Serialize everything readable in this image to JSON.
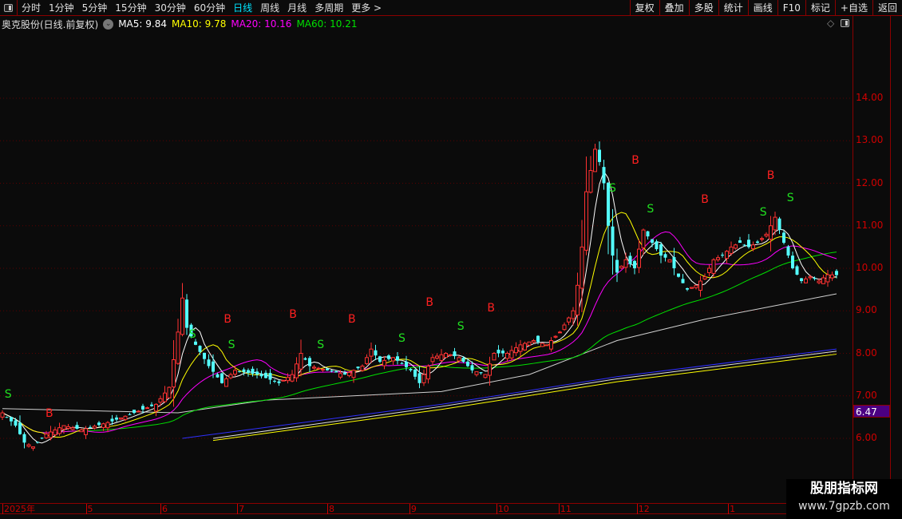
{
  "toolbar": {
    "periods": [
      "分时",
      "1分钟",
      "5分钟",
      "15分钟",
      "30分钟",
      "60分钟",
      "日线",
      "周线",
      "月线",
      "多周期",
      "更多 >"
    ],
    "active": "日线",
    "right_buttons": [
      "复权",
      "叠加",
      "多股",
      "统计",
      "画线",
      "F10",
      "标记",
      "+自选",
      "返回"
    ]
  },
  "info": {
    "title": "奥克股份(日线.前复权)",
    "ma5": "MA5: 9.84",
    "ma10": "MA10: 9.78",
    "ma20": "MA20: 10.16",
    "ma60": "MA60: 10.21"
  },
  "colors": {
    "up": "#ff3232",
    "down": "#54ffff",
    "ma5": "#ffffff",
    "ma10": "#ffff00",
    "ma20": "#ff00ff",
    "ma60": "#00e000",
    "buy": "#ff2020",
    "sell": "#20e020"
  },
  "axis": {
    "prices": [
      "14.00",
      "13.00",
      "12.00",
      "11.00",
      "10.00",
      "9.00",
      "8.00",
      "7.00",
      "6.00"
    ],
    "current_price": "6.47",
    "dates": [
      {
        "label": "2025年",
        "day": 0
      },
      {
        "label": "5",
        "day": 19
      },
      {
        "label": "6",
        "day": 36
      },
      {
        "label": "7",
        "day": 53.5
      },
      {
        "label": "8",
        "day": 74
      },
      {
        "label": "9",
        "day": 92.7
      },
      {
        "label": "10",
        "day": 112.5
      },
      {
        "label": "11",
        "day": 126.7
      },
      {
        "label": "12",
        "day": 144.5
      },
      {
        "label": "1",
        "day": 165.3
      }
    ]
  },
  "chart_data": {
    "type": "candlestick",
    "ylim": [
      5.0,
      15.0
    ],
    "close_keypoints": [
      [
        0,
        6.6
      ],
      [
        3,
        6.3
      ],
      [
        5,
        5.9
      ],
      [
        7,
        5.8
      ],
      [
        10,
        6.1
      ],
      [
        14,
        6.3
      ],
      [
        18,
        6.2
      ],
      [
        25,
        6.4
      ],
      [
        30,
        6.6
      ],
      [
        35,
        6.8
      ],
      [
        38,
        7.2
      ],
      [
        40,
        8.5
      ],
      [
        41,
        9.3
      ],
      [
        42,
        8.6
      ],
      [
        44,
        8.2
      ],
      [
        47,
        7.7
      ],
      [
        50,
        7.3
      ],
      [
        53,
        7.6
      ],
      [
        58,
        7.5
      ],
      [
        63,
        7.3
      ],
      [
        66,
        7.5
      ],
      [
        68,
        8.0
      ],
      [
        70,
        7.7
      ],
      [
        74,
        7.6
      ],
      [
        78,
        7.5
      ],
      [
        82,
        7.7
      ],
      [
        84,
        8.1
      ],
      [
        86,
        7.8
      ],
      [
        89,
        7.9
      ],
      [
        93,
        7.6
      ],
      [
        95,
        7.3
      ],
      [
        98,
        7.9
      ],
      [
        101,
        8.0
      ],
      [
        104,
        7.9
      ],
      [
        107,
        7.6
      ],
      [
        110,
        7.5
      ],
      [
        112,
        8.0
      ],
      [
        115,
        8.0
      ],
      [
        118,
        8.2
      ],
      [
        121,
        8.3
      ],
      [
        124,
        8.2
      ],
      [
        127,
        8.5
      ],
      [
        130,
        9.0
      ],
      [
        131,
        9.6
      ],
      [
        132,
        10.5
      ],
      [
        133,
        11.8
      ],
      [
        134,
        12.3
      ],
      [
        135,
        12.8
      ],
      [
        136,
        12.5
      ],
      [
        137,
        12.0
      ],
      [
        138,
        11.0
      ],
      [
        139,
        10.3
      ],
      [
        140,
        9.9
      ],
      [
        142,
        10.2
      ],
      [
        144,
        10.0
      ],
      [
        146,
        10.9
      ],
      [
        148,
        10.6
      ],
      [
        150,
        10.3
      ],
      [
        152,
        10.2
      ],
      [
        154,
        9.8
      ],
      [
        156,
        9.5
      ],
      [
        158,
        9.6
      ],
      [
        160,
        9.8
      ],
      [
        162,
        10.2
      ],
      [
        164,
        10.3
      ],
      [
        166,
        10.5
      ],
      [
        168,
        10.6
      ],
      [
        170,
        10.5
      ],
      [
        172,
        10.6
      ],
      [
        174,
        10.8
      ],
      [
        176,
        11.2
      ],
      [
        178,
        10.6
      ],
      [
        180,
        10.0
      ],
      [
        182,
        9.7
      ],
      [
        184,
        9.8
      ],
      [
        186,
        9.7
      ],
      [
        188,
        9.85
      ],
      [
        190,
        9.84
      ]
    ],
    "long_lines": [
      {
        "name": "white-long",
        "color": "#d0d0d0",
        "points": [
          [
            0,
            6.7
          ],
          [
            40,
            6.6
          ],
          [
            60,
            6.9
          ],
          [
            100,
            7.1
          ],
          [
            120,
            7.5
          ],
          [
            140,
            8.3
          ],
          [
            160,
            8.8
          ],
          [
            190,
            9.4
          ]
        ]
      },
      {
        "name": "blue-long",
        "color": "#3030ff",
        "points": [
          [
            41,
            6.0
          ],
          [
            100,
            6.8
          ],
          [
            140,
            7.45
          ],
          [
            190,
            8.1
          ]
        ]
      },
      {
        "name": "white-long-2",
        "color": "#e0e0e0",
        "points": [
          [
            48,
            6.0
          ],
          [
            100,
            6.75
          ],
          [
            140,
            7.4
          ],
          [
            190,
            8.05
          ]
        ]
      },
      {
        "name": "yellow-long",
        "color": "#ffff00",
        "points": [
          [
            48,
            5.95
          ],
          [
            100,
            6.68
          ],
          [
            140,
            7.33
          ],
          [
            190,
            7.98
          ]
        ]
      }
    ],
    "signals": [
      [
        "S",
        1.3,
        6.96
      ],
      [
        "B",
        10.7,
        6.51
      ],
      [
        "S",
        43.3,
        8.37
      ],
      [
        "B",
        51.3,
        8.72
      ],
      [
        "S",
        52.2,
        8.12
      ],
      [
        "B",
        66.2,
        8.84
      ],
      [
        "S",
        72.5,
        8.12
      ],
      [
        "B",
        79.6,
        8.72
      ],
      [
        "S",
        91,
        8.27
      ],
      [
        "B",
        97.3,
        9.12
      ],
      [
        "S",
        104.4,
        8.55
      ],
      [
        "B",
        111.3,
        8.99
      ],
      [
        "S",
        139,
        11.8
      ],
      [
        "B",
        144.2,
        12.46
      ],
      [
        "S",
        147.6,
        11.31
      ],
      [
        "B",
        160,
        11.54
      ],
      [
        "S",
        173.3,
        11.24
      ],
      [
        "B",
        175,
        12.1
      ],
      [
        "S",
        179.5,
        11.58
      ]
    ]
  },
  "watermark": {
    "name": "股朋指标网",
    "url": "www.7gpzb.com"
  }
}
